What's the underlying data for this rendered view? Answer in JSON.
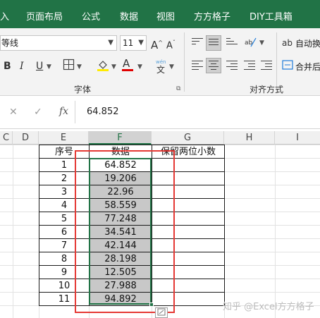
{
  "ribbon_tabs": [
    "入",
    "页面布局",
    "公式",
    "数据",
    "视图",
    "方方格子",
    "DIY工具箱"
  ],
  "font": {
    "name": "等线",
    "size": "11"
  },
  "ribbon_buttons": {
    "bold": "B",
    "italic": "I",
    "underline": "U",
    "increase_font": "A",
    "decrease_font": "A",
    "font_color": "A",
    "phonetic_top": "wén",
    "phonetic_bottom": "文",
    "wrap_text": "自动换",
    "merge_center": "合并后"
  },
  "group_labels": {
    "font": "字体",
    "alignment": "对齐方式"
  },
  "formula_bar": {
    "cancel": "✕",
    "enter": "✓",
    "fx": "fx",
    "value": "64.852"
  },
  "columns": [
    "C",
    "D",
    "E",
    "F",
    "G",
    "H",
    "I"
  ],
  "table": {
    "header_seq": "序号",
    "header_data": "数据",
    "header_round": "保留两位小数",
    "seq": [
      "1",
      "2",
      "3",
      "4",
      "5",
      "6",
      "7",
      "8",
      "9",
      "10",
      "11"
    ],
    "values": [
      "64.852",
      "19.206",
      "22.96",
      "58.559",
      "77.248",
      "34.541",
      "42.144",
      "28.198",
      "12.505",
      "27.988",
      "94.892"
    ]
  },
  "quick_analysis_icon": "quick-analysis-icon",
  "watermark": "知乎 @Excel方方格子",
  "colors": {
    "ribbon_green": "#217346",
    "highlight_red": "#e53935",
    "selection_gray": "#c8c8c8"
  }
}
